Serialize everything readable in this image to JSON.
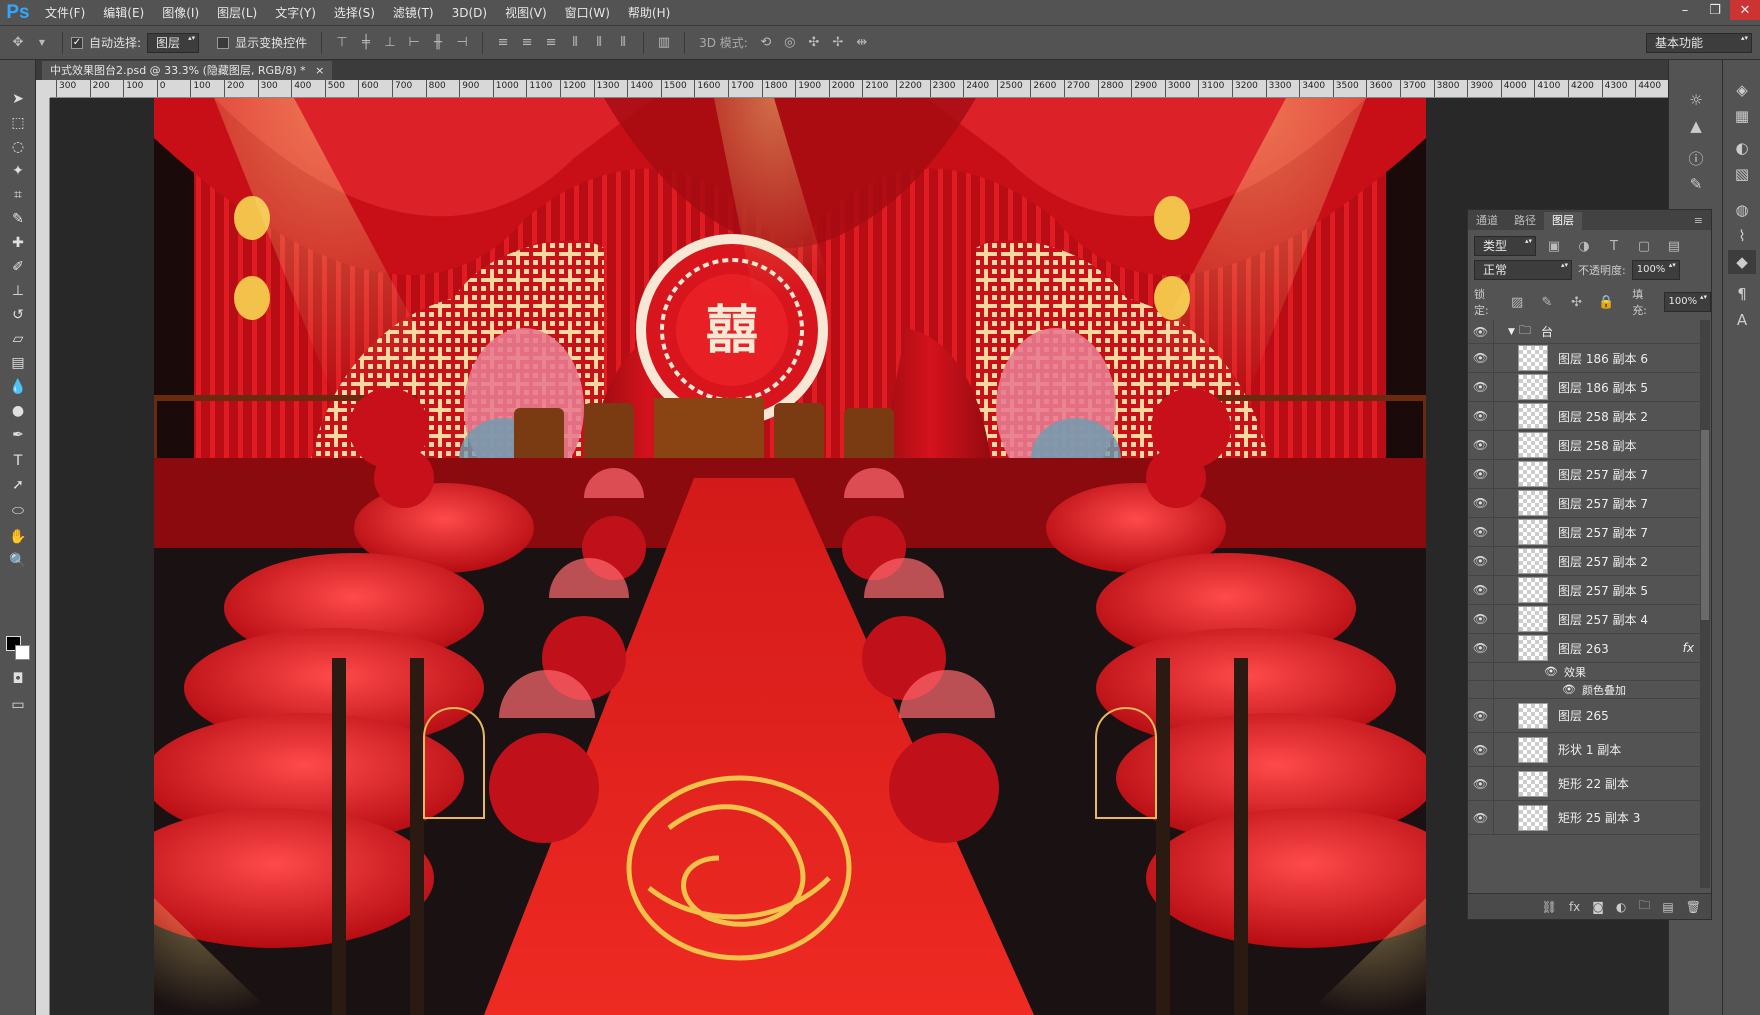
{
  "app": {
    "logo": "Ps"
  },
  "menu": [
    "文件(F)",
    "编辑(E)",
    "图像(I)",
    "图层(L)",
    "文字(Y)",
    "选择(S)",
    "滤镜(T)",
    "3D(D)",
    "视图(V)",
    "窗口(W)",
    "帮助(H)"
  ],
  "options": {
    "auto_select_label": "自动选择:",
    "auto_select_value": "图层",
    "show_transform_label": "显示变换控件",
    "mode_3d_label": "3D 模式:",
    "workspace": "基本功能"
  },
  "document": {
    "tab_title": "中式效果图台2.psd @ 33.3% (隐藏图层, RGB/8) *"
  },
  "ruler": {
    "ticks": [
      "300",
      "200",
      "100",
      "0",
      "100",
      "200",
      "300",
      "400",
      "500",
      "600",
      "700",
      "800",
      "900",
      "1000",
      "1100",
      "1200",
      "1300",
      "1400",
      "1500",
      "1600",
      "1700",
      "1800",
      "1900",
      "2000",
      "2100",
      "2200",
      "2300",
      "2400",
      "2500",
      "2600",
      "2700",
      "2800",
      "2900",
      "3000",
      "3100",
      "3200",
      "3300",
      "3400",
      "3500",
      "3600",
      "3700",
      "3800",
      "3900",
      "4000",
      "4100",
      "4200",
      "4300",
      "4400"
    ]
  },
  "canvas": {
    "symbol": "囍"
  },
  "layers_panel": {
    "tabs": [
      "通道",
      "路径",
      "图层"
    ],
    "filter_kind": "类型",
    "blend_mode": "正常",
    "opacity_label": "不透明度:",
    "opacity_value": "100%",
    "lock_label": "锁定:",
    "fill_label": "填充:",
    "fill_value": "100%",
    "group_name": "台",
    "layers": [
      "图层 186 副本 6",
      "图层 186 副本 5",
      "图层 258 副本 2",
      "图层 258 副本",
      "图层 257 副本 7",
      "图层 257 副本 7",
      "图层 257 副本 7",
      "图层 257 副本 2",
      "图层 257 副本 5",
      "图层 257 副本 4",
      "图层 263"
    ],
    "effects_label": "效果",
    "effect_item": "颜色叠加",
    "fx": "fx",
    "layers_after": [
      "图层 265",
      "形状 1 副本",
      "矩形 22 副本",
      "矩形 25 副本 3"
    ]
  },
  "colors": {
    "accent": "#c8101a",
    "gold": "#f2c24a",
    "panel": "#535353"
  }
}
